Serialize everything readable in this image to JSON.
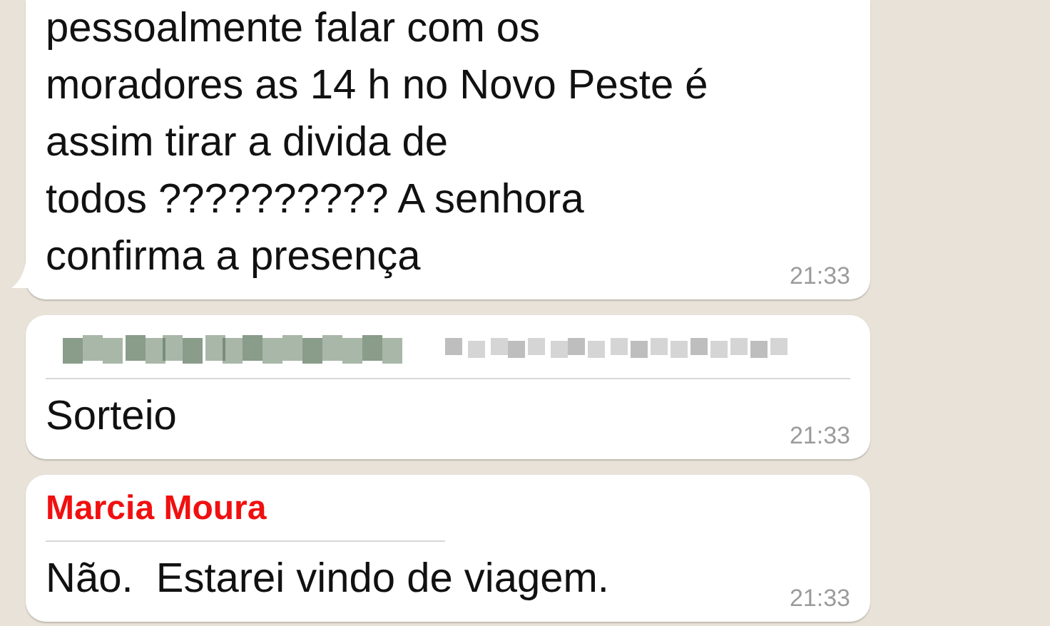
{
  "messages": [
    {
      "kind": "text",
      "text": "pessoalmente falar com os\nmoradores as 14 h no Novo Peste é\nassim tirar a divida de\ntodos ?????????? A senhora\nconfirma a presença",
      "time": "21:33"
    },
    {
      "kind": "blurred_quote",
      "text": "Sorteio",
      "time": "21:33"
    },
    {
      "kind": "sender",
      "sender": "Marcia Moura",
      "text": "Não.  Estarei vindo de viagem.",
      "time": "21:33"
    }
  ]
}
